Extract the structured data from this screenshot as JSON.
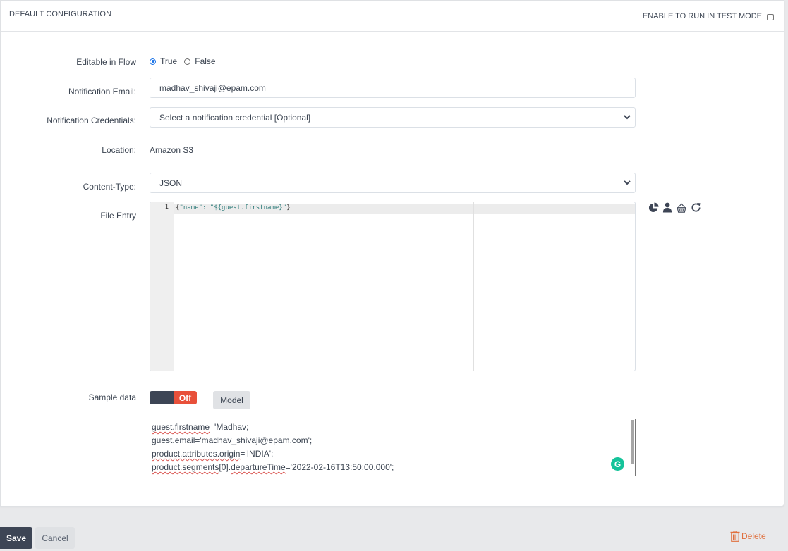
{
  "header": {
    "title": "DEFAULT CONFIGURATION",
    "test_mode_label": "ENABLE TO RUN IN TEST MODE",
    "test_mode_checked": false
  },
  "form": {
    "editable_in_flow": {
      "label": "Editable in Flow",
      "options": [
        "True",
        "False"
      ],
      "selected": "True"
    },
    "notification_email": {
      "label": "Notification Email:",
      "value": "madhav_shivaji@epam.com"
    },
    "notification_credentials": {
      "label": "Notification Credentials:",
      "selected": "Select a notification credential [Optional]"
    },
    "location": {
      "label": "Location:",
      "value": "Amazon S3"
    },
    "content_type": {
      "label": "Content-Type:",
      "selected": "JSON"
    },
    "file_entry": {
      "label": "File Entry",
      "line_number": "1",
      "code_open": "{",
      "code_body": "\"name\": \"${guest.firstname}\"",
      "code_close": "}",
      "tools": [
        "pie-chart-icon",
        "user-icon",
        "basket-icon",
        "refresh-icon"
      ]
    },
    "sample_data": {
      "label": "Sample data",
      "toggle_state": "Off",
      "model_button": "Model",
      "lines": [
        {
          "key": "guest.firstname",
          "rest": "='Madhav;"
        },
        {
          "key": "",
          "rest": "guest.email='madhav_shivaji@epam.com';"
        },
        {
          "key": "product.attributes.origin",
          "rest": "='INDIA';"
        },
        {
          "key": "product.segments",
          "rest": "[0].",
          "key2": "departureTime",
          "rest2": "='2022-02-16T13:50:00.000';"
        }
      ]
    }
  },
  "footer": {
    "save": "Save",
    "cancel": "Cancel",
    "delete": "Delete"
  },
  "colors": {
    "primary_dark": "#3d4555",
    "toggle_off": "#e8503a",
    "delete": "#e0703e",
    "radio_accent": "#1a73e8",
    "grammarly": "#15c39a"
  }
}
